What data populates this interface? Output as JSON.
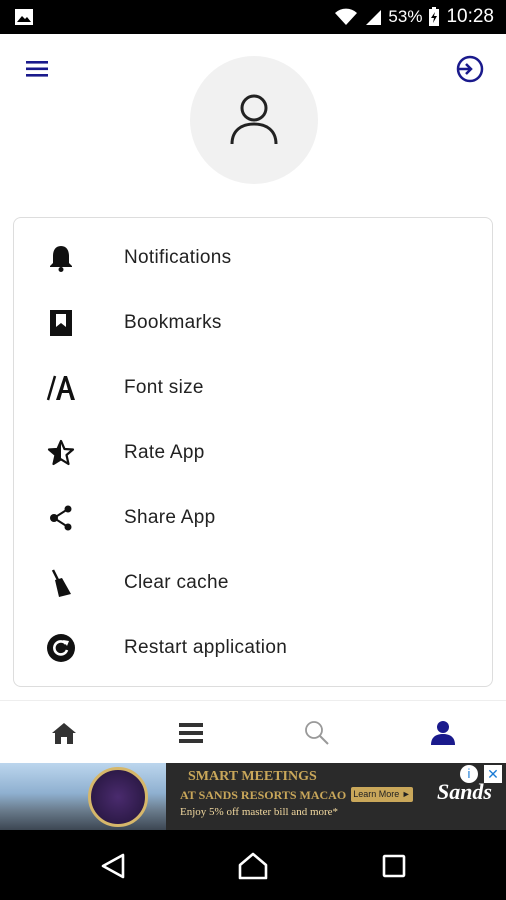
{
  "status_bar": {
    "battery": "53%",
    "time": "10:28"
  },
  "menu": {
    "items": [
      {
        "label": "Notifications",
        "icon": "bell-icon"
      },
      {
        "label": "Bookmarks",
        "icon": "bookmark-icon"
      },
      {
        "label": "Font size",
        "icon": "font-size-icon"
      },
      {
        "label": "Rate App",
        "icon": "star-half-icon"
      },
      {
        "label": "Share App",
        "icon": "share-icon"
      },
      {
        "label": "Clear cache",
        "icon": "broom-icon"
      },
      {
        "label": "Restart application",
        "icon": "restart-icon"
      }
    ]
  },
  "bottom_nav": {
    "items": [
      "home-icon",
      "list-icon",
      "search-icon",
      "profile-icon"
    ],
    "active": "profile-icon",
    "accent": "#1a1a8c"
  },
  "ad": {
    "headline": "SMART MEETINGS",
    "subline": "AT SANDS RESORTS MACAO",
    "offer": "Enjoy 5% off master bill and more*",
    "cta": "Learn More ►",
    "brand": "Sands",
    "info": "i",
    "close": "✕"
  },
  "colors": {
    "accent": "#1a1a8c",
    "icon_dark": "#111111",
    "text": "#222222"
  }
}
